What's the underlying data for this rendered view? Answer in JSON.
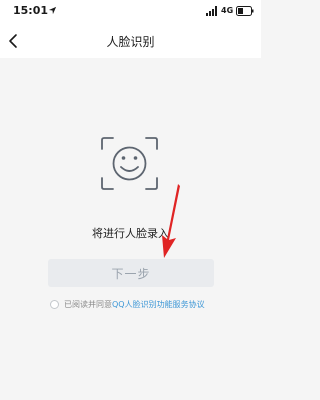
{
  "status_bar": {
    "time": "15:01",
    "network": "4G"
  },
  "nav": {
    "title": "人脸识别"
  },
  "main": {
    "prompt": "将进行人脸录入",
    "next_button_label": "下一步",
    "agreement_prefix": "已阅读并同意",
    "agreement_link": "QQ人脸识别功能服务协议"
  },
  "colors": {
    "link": "#3d97d6",
    "button_bg": "#e9ebee",
    "button_text": "#9aa3ad",
    "annotation_arrow": "#e02424"
  },
  "icons": [
    "location-arrow-icon",
    "signal-icon",
    "battery-icon",
    "back-icon",
    "face-scan-icon"
  ]
}
